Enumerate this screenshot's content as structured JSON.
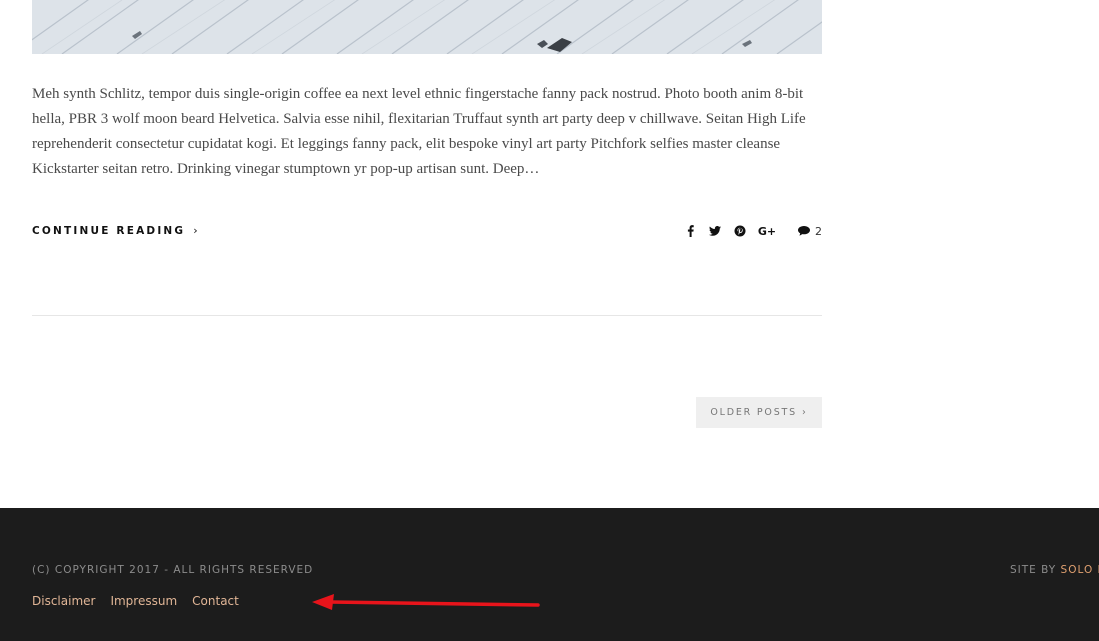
{
  "post": {
    "excerpt": "Meh synth Schlitz, tempor duis single-origin coffee ea next level ethnic fingerstache fanny pack nostrud. Photo booth anim 8-bit hella, PBR 3 wolf moon beard Helvetica. Salvia esse nihil, flexitarian Truffaut synth art party deep v chillwave. Seitan High Life reprehenderit consectetur cupidatat kogi. Et leggings fanny pack, elit bespoke vinyl art party Pitchfork selfies master cleanse Kickstarter seitan retro. Drinking vinegar stumptown yr pop-up artisan sunt. Deep…",
    "continue_label": "CONTINUE READING",
    "continue_chevron": "›",
    "comment_count": "2",
    "share_icons": [
      "facebook-icon",
      "twitter-icon",
      "pinterest-icon",
      "google-plus-icon"
    ],
    "google_plus_glyph": "G+"
  },
  "pagination": {
    "older_label": "OLDER POSTS",
    "older_chevron": "›"
  },
  "footer": {
    "copyright": "(C) COPYRIGHT 2017 - ALL RIGHTS RESERVED",
    "links": [
      "Disclaimer",
      "Impressum",
      "Contact"
    ],
    "site_by_label": "SITE BY",
    "site_by_brand": "SOLO P"
  },
  "colors": {
    "footer_bg": "#1c1c1c",
    "footer_link": "#e0b596",
    "annotation_arrow": "#e8141b"
  }
}
